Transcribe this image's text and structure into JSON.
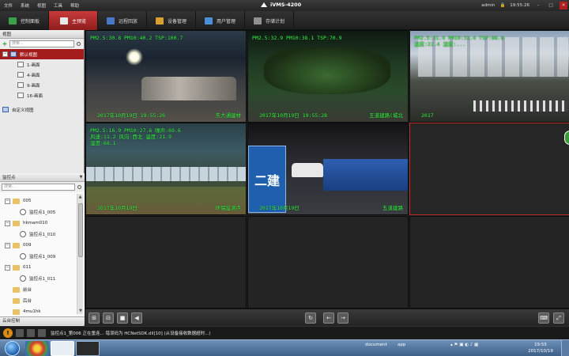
{
  "menubar": {
    "menus": [
      "文件",
      "系统",
      "视图",
      "工具",
      "帮助"
    ],
    "app_title": "iVMS-4200",
    "user": "admin",
    "time": "19:55:26"
  },
  "tabs": [
    {
      "label": "控制面板",
      "icon_color": "#3aa04a",
      "active": false
    },
    {
      "label": "主预览",
      "icon_color": "#e8e8e8",
      "active": true
    },
    {
      "label": "远程回放",
      "icon_color": "#4a78c8",
      "active": false
    },
    {
      "label": "设备管理",
      "icon_color": "#d8a030",
      "active": false
    },
    {
      "label": "用户管理",
      "icon_color": "#4a90d8",
      "active": false
    },
    {
      "label": "存储计划",
      "icon_color": "#909090",
      "active": false
    }
  ],
  "view_panel": {
    "header": "视图",
    "search_placeholder": "搜索...",
    "items": [
      {
        "label": "默认视图",
        "level": 0,
        "selected": true,
        "kind": "view"
      },
      {
        "label": "1-画面",
        "level": 1,
        "kind": "layout"
      },
      {
        "label": "4-画面",
        "level": 1,
        "kind": "layout"
      },
      {
        "label": "9-画面",
        "level": 1,
        "kind": "layout"
      },
      {
        "label": "16-画面",
        "level": 1,
        "kind": "layout"
      },
      {
        "label": "自定义视图",
        "level": 0,
        "kind": "view"
      }
    ]
  },
  "camera_panel": {
    "header": "监控点",
    "search_placeholder": "搜索...",
    "items": [
      {
        "label": "005",
        "kind": "group"
      },
      {
        "label": "监控点1_005",
        "kind": "camera"
      },
      {
        "label": "hkmam010",
        "kind": "group"
      },
      {
        "label": "监控点1_010",
        "kind": "camera"
      },
      {
        "label": "009",
        "kind": "group"
      },
      {
        "label": "监控点1_009",
        "kind": "camera"
      },
      {
        "label": "011",
        "kind": "group"
      },
      {
        "label": "监控点1_011",
        "kind": "camera"
      },
      {
        "label": "前台",
        "kind": "group"
      },
      {
        "label": "后台",
        "kind": "group"
      },
      {
        "label": "4mu1hk",
        "kind": "group"
      }
    ]
  },
  "ptz_panel": {
    "header": "云台控制"
  },
  "cells": [
    {
      "osd1": "PM2.5:30.8 PM10:40.2 TSP:100.7",
      "osd2": "",
      "osd_bottom": "2017年10月19日  19:55:26",
      "osd_corner": "东大通建材"
    },
    {
      "osd1": "PM2.5:32.9 PM10:38.1 TSP:70.9",
      "osd2": "",
      "osd_bottom": "2017年10月19日 19:55:28",
      "osd_corner": "五道建路(城北"
    },
    {
      "osd1": "PM2.5:31.4 PM10:32.4 TSP:88.8",
      "osd2": "温度:22.4 湿度:...",
      "osd_bottom": "2017",
      "osd_corner": ""
    },
    {
      "osd1": "PM2.5:16.9 PM10:27.6 噪声:69.6",
      "osd2": "风速:11.2 风向:西北 温度:21.9",
      "osd3": "湿度:68.1",
      "osd_bottom": "2017年10月19日",
      "osd_corner": "环保监测点"
    },
    {
      "osd1": "",
      "osd2": "",
      "osd_bottom": "2017年10月19日",
      "osd_corner": "五道建路",
      "sign_text": "二建"
    },
    {
      "osd1": "",
      "osd2": "",
      "osd_bottom": "",
      "osd_corner": ""
    }
  ],
  "statusbar": {
    "message": "监控点1_第006 正在重连... 错误码为 HCNetSDK.dll[10] (从设备接收数据超时...)"
  },
  "taskbar": {
    "tray_labels": [
      "document",
      "app"
    ],
    "clock_time": "19:55",
    "clock_date": "2017/10/19"
  }
}
